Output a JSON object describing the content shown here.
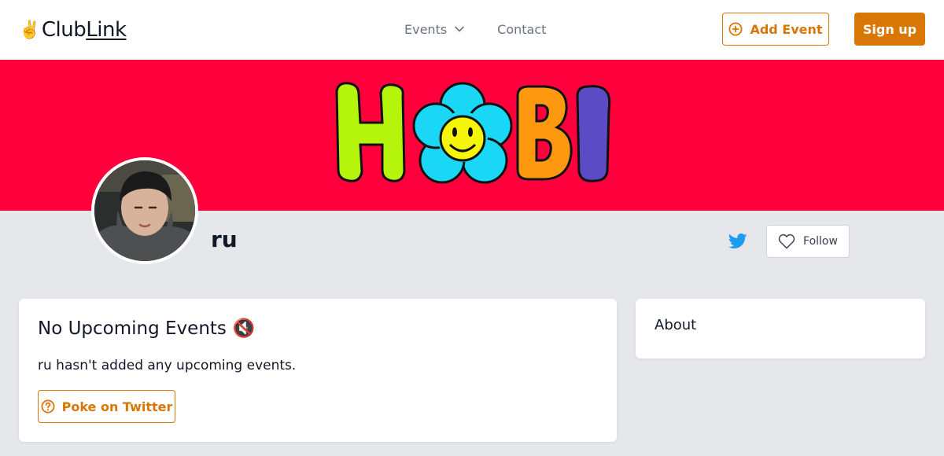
{
  "header": {
    "logo_emoji": "✌️",
    "logo_club": "Club",
    "logo_link": "Link",
    "nav": [
      {
        "label": "Events",
        "icon": "chevron-down-icon"
      },
      {
        "label": "Contact"
      }
    ],
    "add_event_label": "Add Event",
    "sign_up_label": "Sign up"
  },
  "banner": {
    "text": "HOBI",
    "background_color": "#ff003c"
  },
  "profile": {
    "name": "ru",
    "follow_label": "Follow"
  },
  "events": {
    "title": "No Upcoming Events",
    "title_emoji": "🔇",
    "description": "ru hasn't added any upcoming events.",
    "poke_label": "Poke on Twitter"
  },
  "about": {
    "title": "About"
  },
  "colors": {
    "accent": "#d97706",
    "twitter": "#1d9bf0",
    "page_background": "#e5e7eb"
  }
}
